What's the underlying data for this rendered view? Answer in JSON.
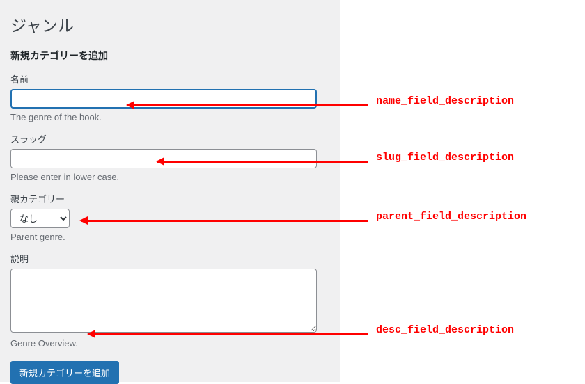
{
  "page": {
    "title": "ジャンル",
    "subheading": "新規カテゴリーを追加"
  },
  "form": {
    "name": {
      "label": "名前",
      "value": "",
      "help": "The genre of the book."
    },
    "slug": {
      "label": "スラッグ",
      "value": "",
      "help": "Please enter in lower case."
    },
    "parent": {
      "label": "親カテゴリー",
      "selected": "なし",
      "help": "Parent genre."
    },
    "desc": {
      "label": "説明",
      "value": "",
      "help": "Genre Overview."
    },
    "submit_label": "新規カテゴリーを追加"
  },
  "annotations": {
    "name": "name_field_description",
    "slug": "slug_field_description",
    "parent": "parent_field_description",
    "desc": "desc_field_description"
  }
}
